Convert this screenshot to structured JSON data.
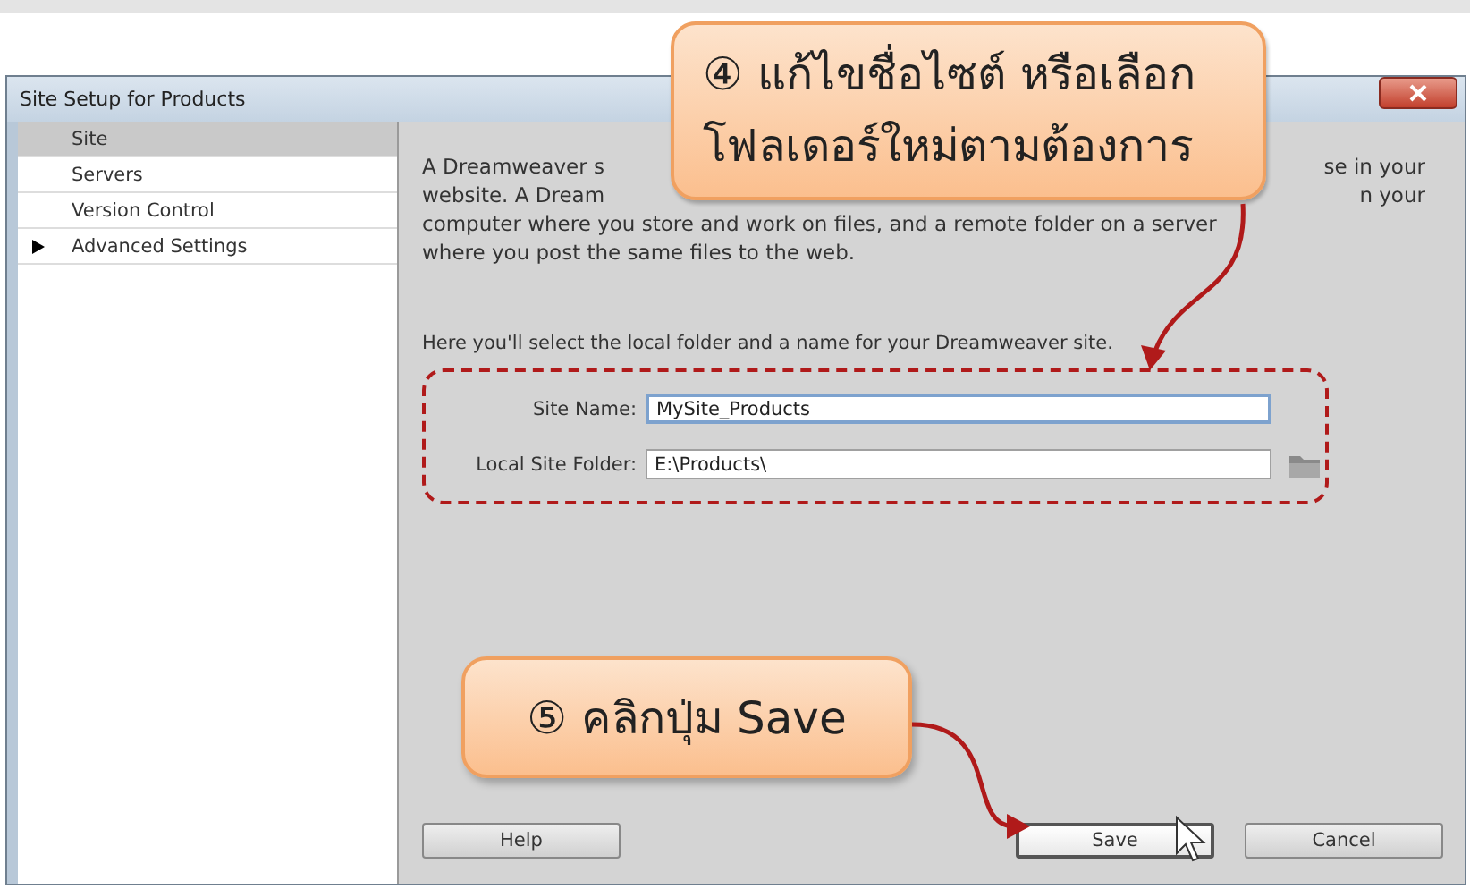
{
  "window": {
    "title": "Site Setup for Products"
  },
  "sidebar": {
    "items": [
      {
        "label": "Site",
        "selected": true,
        "expandable": false
      },
      {
        "label": "Servers",
        "selected": false,
        "expandable": false
      },
      {
        "label": "Version Control",
        "selected": false,
        "expandable": false
      },
      {
        "label": "Advanced Settings",
        "selected": false,
        "expandable": true
      }
    ]
  },
  "intro_lines": [
    {
      "left": "A Dreamweaver s",
      "right": "se in your"
    },
    {
      "left": "website. A Dream",
      "right": "n your"
    },
    {
      "left": "computer where you store and work on files, and a remote folder on a server"
    },
    {
      "left": "where you post the same files to the web."
    }
  ],
  "instruction": "Here you'll select the local folder and a name for your Dreamweaver site.",
  "fields": [
    {
      "label": "Site Name:",
      "value": "MySite_Products",
      "focused": true,
      "browse": false
    },
    {
      "label": "Local Site Folder:",
      "value": "E:\\Products\\",
      "focused": false,
      "browse": true
    }
  ],
  "buttons": [
    {
      "label": "Help",
      "focused": false
    },
    {
      "label": "Save",
      "focused": true
    },
    {
      "label": "Cancel",
      "focused": false
    }
  ],
  "callouts": [
    {
      "number": "④",
      "lines": [
        "แก้ไขชื่อไซต์ หรือเลือก",
        "โฟลเดอร์ใหม่ตามต้องการ"
      ]
    },
    {
      "number": "⑤",
      "lines": [
        "คลิกปุ่ม Save"
      ]
    }
  ]
}
